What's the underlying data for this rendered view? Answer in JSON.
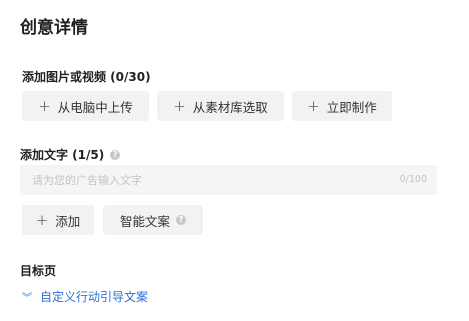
{
  "header": {
    "title": "创意详情"
  },
  "media": {
    "label": "添加图片或视频 (0/30)",
    "buttons": [
      {
        "label": "从电脑中上传"
      },
      {
        "label": "从素材库选取"
      },
      {
        "label": "立即制作"
      }
    ]
  },
  "text": {
    "label": "添加文字 (1/5)",
    "input_placeholder": "请为您的广告输入文字",
    "counter": "0/100",
    "add_label": "添加",
    "smart_label": "智能文案"
  },
  "target": {
    "label": "目标页",
    "cta_link": "自定义行动引导文案"
  },
  "icons": {
    "add": "plus-icon",
    "help": "question-circle-icon",
    "expand": "double-chevron-down-icon"
  }
}
